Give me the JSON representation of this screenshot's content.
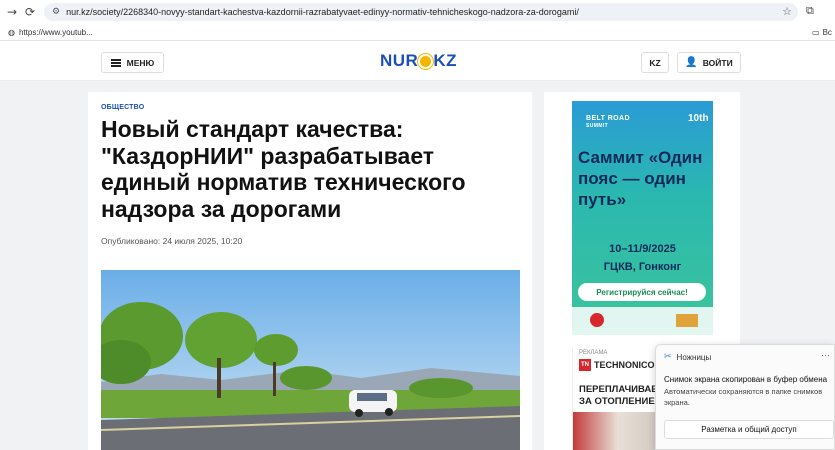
{
  "browser": {
    "url": "nur.kz/society/2268340-novyy-standart-kachestva-kazdornii-razrabatyvaet-edinyy-normativ-tehnicheskogo-nadzora-za-dorogami/",
    "bookmark_label": "https://www.youtub...",
    "bookmarks_right_label": "Вс"
  },
  "header": {
    "menu_label": "МЕНЮ",
    "logo_left": "NUR",
    "logo_right": "KZ",
    "lang_label": "KZ",
    "login_label": "ВОЙТИ"
  },
  "article": {
    "category": "ОБЩЕСТВО",
    "title": "Новый стандарт качества: \"КаздорНИИ\" разрабатывает единый норматив технического надзора за дорогами",
    "published": "Опубликовано: 24 июля 2025, 10:20"
  },
  "ad_summit": {
    "brand": "BELT ROAD",
    "brand_sub": "SUMMIT",
    "tenth": "10th",
    "title": "Саммит «Один пояс — один путь»",
    "dates": "10–11/9/2025",
    "place": "ГЦКВ, Гонконг",
    "cta": "Регистрируйся сейчас!"
  },
  "ad_technonicol": {
    "label": "РЕКЛАМА",
    "brand": "TECHNONICO",
    "line1": "ПЕРЕПЛАЧИВАЕ",
    "line2": "ЗА ОТОПЛЕНИЕ"
  },
  "snip_toast": {
    "app_name": "Ножницы",
    "title": "Снимок экрана скопирован в буфер обмена",
    "subtitle": "Автоматически сохраняются в папке снимков экрана.",
    "button": "Разметка и общий доступ"
  },
  "colors": {
    "brand_blue": "#1b4fb8",
    "sun_yellow": "#f7b500",
    "ad_dark": "#0b2a5a"
  }
}
